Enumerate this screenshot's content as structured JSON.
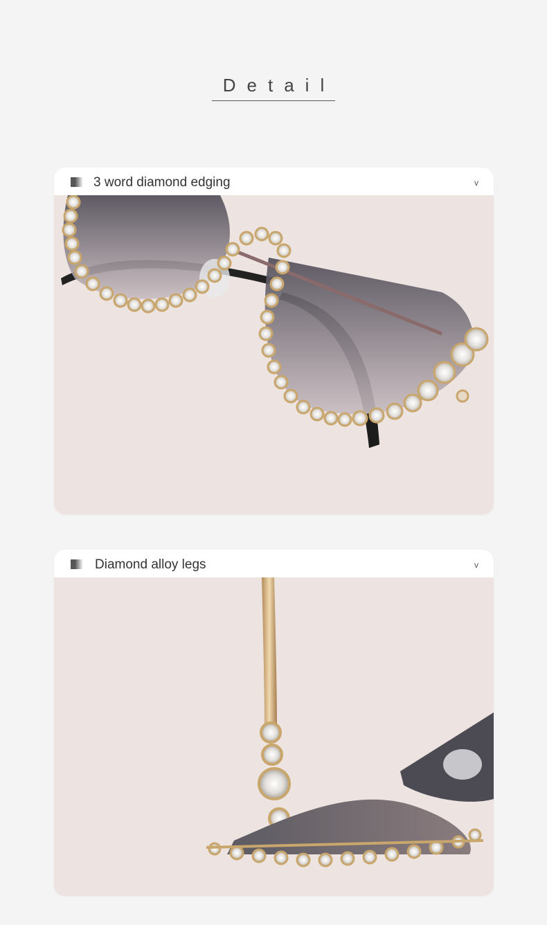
{
  "page": {
    "title": "Detail"
  },
  "cards": [
    {
      "title": "3 word diamond edging",
      "chevron": "v",
      "image": "glasses-diamond-edging-photo"
    },
    {
      "title": "Diamond alloy legs",
      "chevron": "v",
      "image": "glasses-alloy-legs-photo"
    }
  ],
  "colors": {
    "background": "#f4f4f4",
    "card_bg": "#ede4e2",
    "gold": "#c9a66b",
    "lens": "#5a5560"
  }
}
